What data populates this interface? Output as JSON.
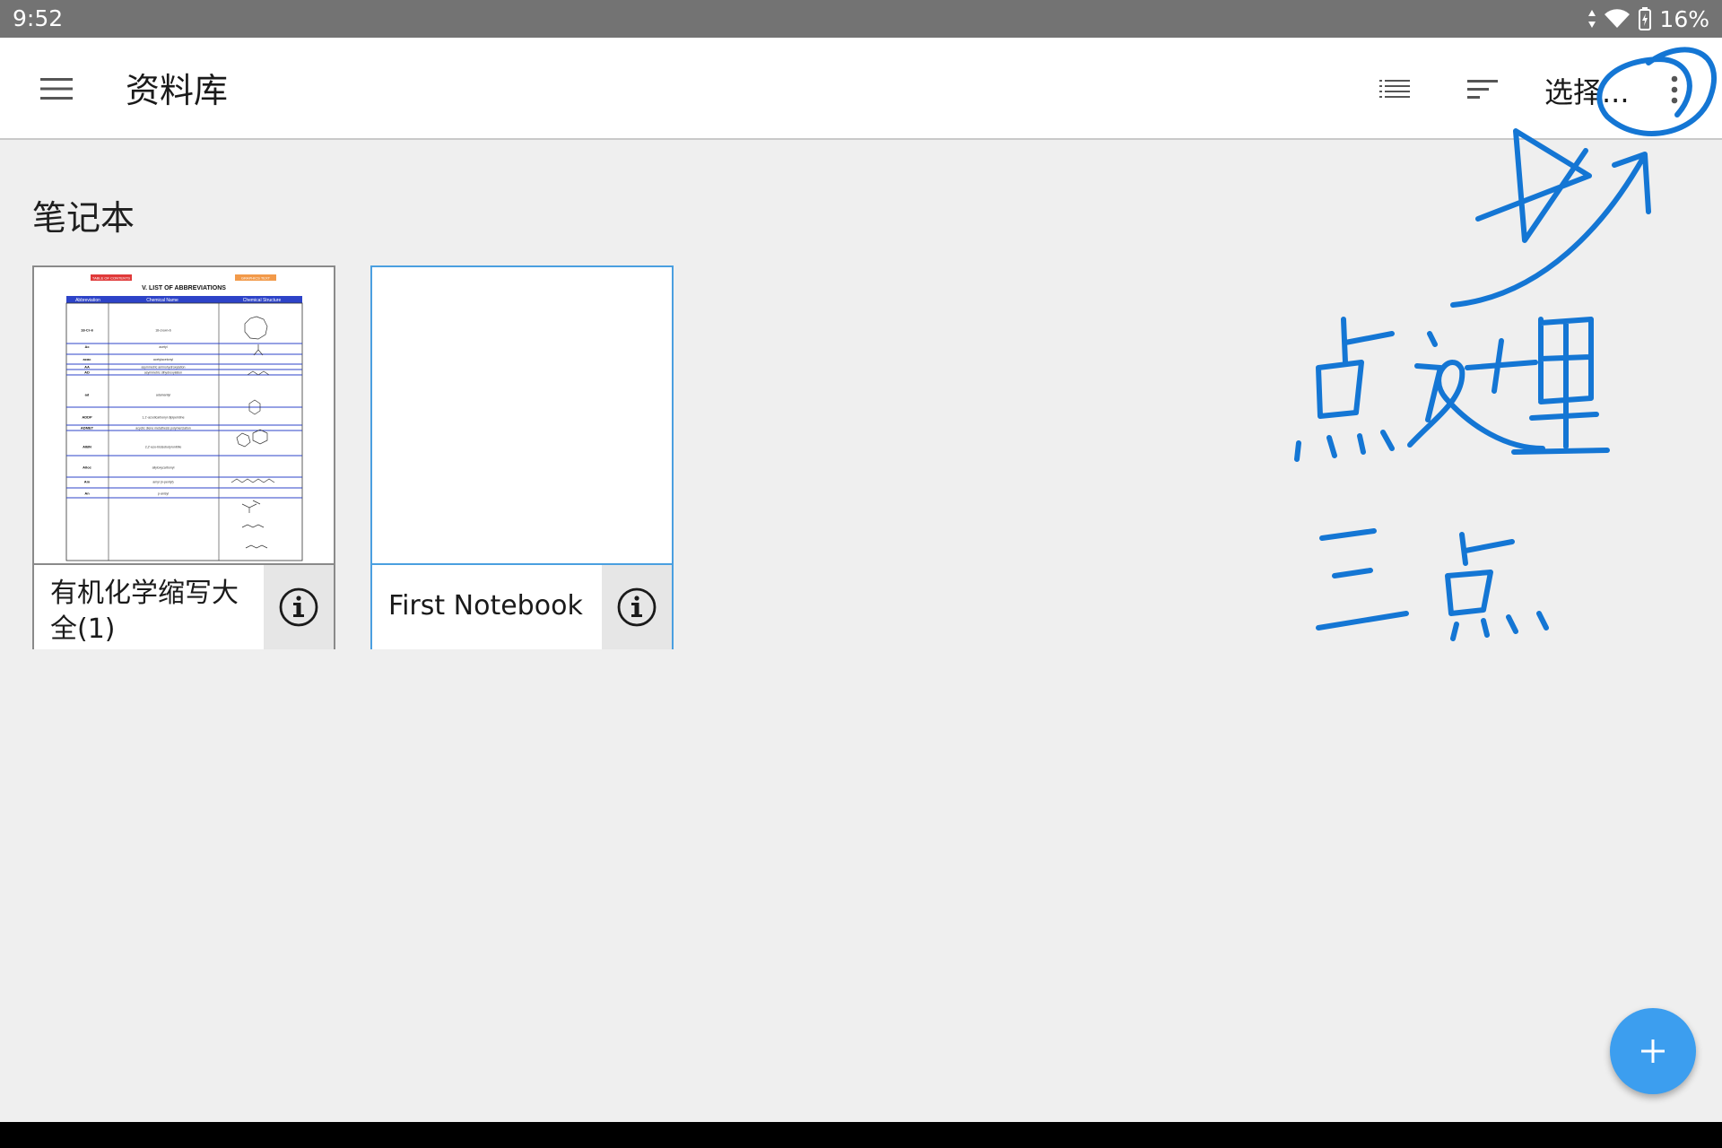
{
  "status_bar": {
    "time": "9:52",
    "battery": "16%"
  },
  "app_bar": {
    "title": "资料库",
    "select_label": "选择..."
  },
  "section": {
    "title": "笔记本"
  },
  "notebooks": [
    {
      "title": "有机化学缩写大全(1)"
    },
    {
      "title": "First Notebook"
    }
  ],
  "thumbnail_doc": {
    "left_tag": "TABLE OF CONTENTS",
    "right_tag": "GRAPHICS TEXT",
    "heading": "V. LIST OF ABBREVIATIONS",
    "columns": [
      "Abbreviation",
      "Chemical Name",
      "Chemical Structure"
    ],
    "rows": [
      [
        "18-Cr-6",
        "18-crown-6"
      ],
      [
        "Ac",
        "acetyl"
      ],
      [
        "acac",
        "acetylacetonyl"
      ],
      [
        "AA",
        "asymmetric aminohydroxylation"
      ],
      [
        "AD",
        "asymmetric dihydroxylation"
      ],
      [
        "ad",
        "adamantyl"
      ],
      [
        "ADDP",
        "1,1'-azodicarbonyl dipiperidine"
      ],
      [
        "ADMET",
        "acyclic diene metathesis polymerization"
      ],
      [
        "AIBN",
        "2,2'-azo-bisisobutyronitrile"
      ],
      [
        "Alloc",
        "allyloxycarbonyl"
      ],
      [
        "Am",
        "amyl (n-pentyl)"
      ],
      [
        "An",
        "p-anisyl"
      ]
    ]
  },
  "annotation": {
    "hint_text": "点这里 三点"
  },
  "colors": {
    "accent": "#3c9eef",
    "annotation_ink": "#1476d4",
    "status_bar": "#737373"
  }
}
